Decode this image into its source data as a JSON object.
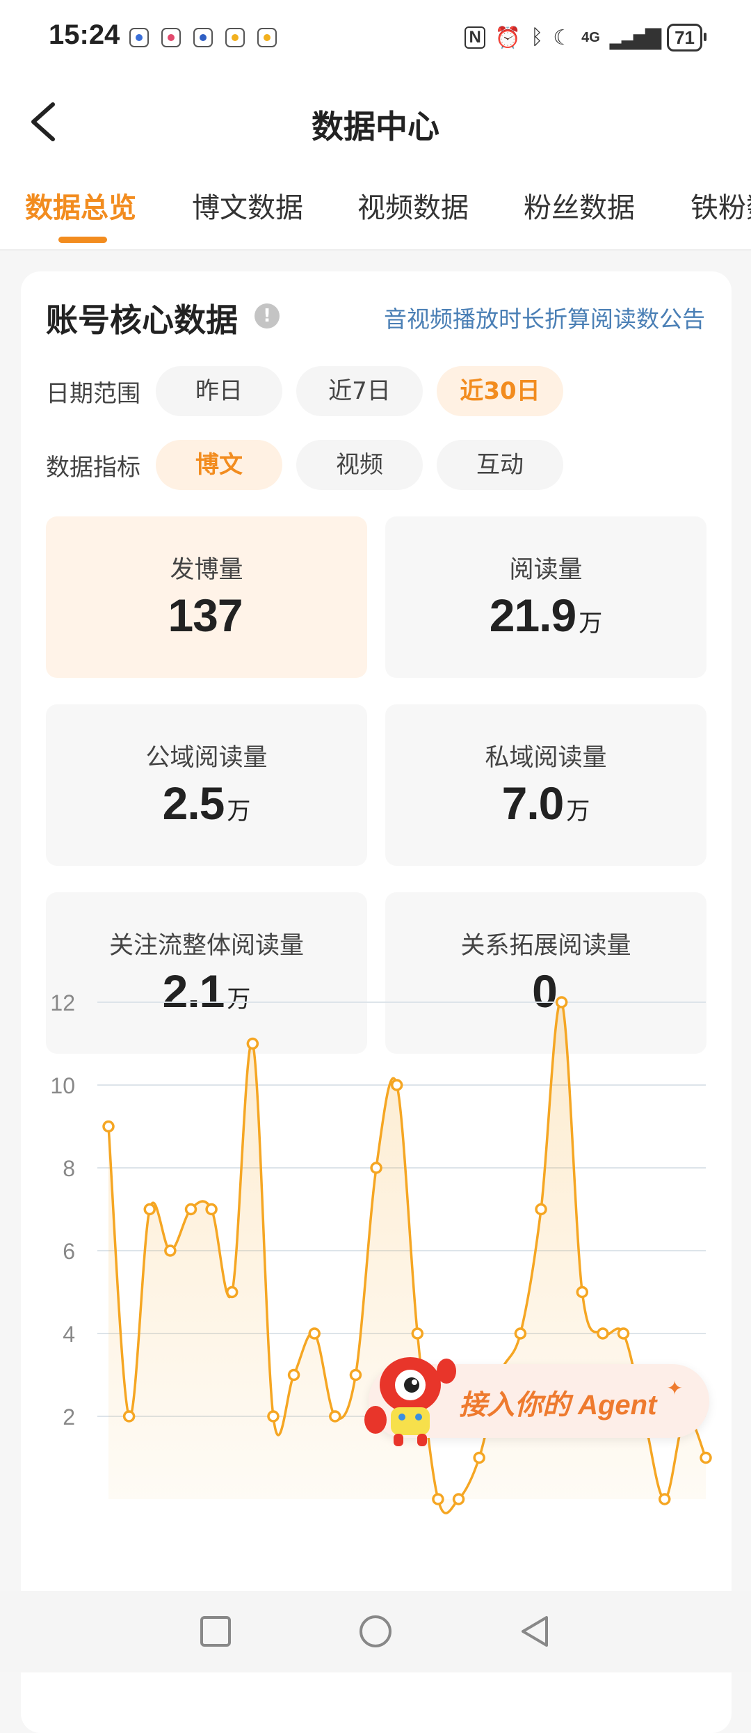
{
  "status_bar": {
    "time": "15:24",
    "notifications": [
      "app-notification-icon",
      "app-notification-icon",
      "app-notification-icon",
      "app-notification-icon",
      "app-notification-icon"
    ],
    "network": "4G",
    "battery": "71"
  },
  "header": {
    "title": "数据中心"
  },
  "tabs": [
    {
      "label": "数据总览",
      "active": true
    },
    {
      "label": "博文数据"
    },
    {
      "label": "视频数据"
    },
    {
      "label": "粉丝数据"
    },
    {
      "label": "铁粉数据"
    }
  ],
  "section": {
    "title": "账号核心数据",
    "notice": "音视频播放时长折算阅读数公告"
  },
  "filters": {
    "date_label": "日期范围",
    "date_options": [
      "昨日",
      "近7日",
      "近30日"
    ],
    "date_selected": "近30日",
    "metric_label": "数据指标",
    "metric_options": [
      "博文",
      "视频",
      "互动"
    ],
    "metric_selected": "博文"
  },
  "metrics": [
    {
      "label": "发博量",
      "value": "137",
      "unit": ""
    },
    {
      "label": "阅读量",
      "value": "21.9",
      "unit": "万"
    },
    {
      "label": "公域阅读量",
      "value": "2.5",
      "unit": "万"
    },
    {
      "label": "私域阅读量",
      "value": "7.0",
      "unit": "万"
    },
    {
      "label": "关注流整体阅读量",
      "value": "2.1",
      "unit": "万"
    },
    {
      "label": "关系拓展阅读量",
      "value": "0",
      "unit": ""
    }
  ],
  "chart_data": {
    "type": "area",
    "title": "",
    "xlabel": "",
    "ylabel": "",
    "yticks": [
      2,
      4,
      6,
      8,
      10,
      12
    ],
    "ylim": [
      0,
      12
    ],
    "grid": true,
    "color": "#f5a623",
    "x": [
      1,
      2,
      3,
      4,
      5,
      6,
      7,
      8,
      9,
      10,
      11,
      12,
      13,
      14,
      15,
      16,
      17,
      18,
      19,
      20,
      21,
      22,
      23,
      24,
      25,
      26,
      27,
      28,
      29,
      30
    ],
    "values": [
      9,
      2,
      7,
      6,
      7,
      7,
      5,
      11,
      2,
      3,
      4,
      2,
      3,
      8,
      10,
      4,
      0,
      0,
      1,
      3,
      4,
      7,
      12,
      5,
      4,
      4,
      2,
      0,
      2,
      1
    ]
  },
  "agent_banner": {
    "text": "接入你的 Agent"
  },
  "bottom_nav": [
    "recent-apps-icon",
    "home-icon",
    "back-icon"
  ],
  "colors": {
    "accent": "#f28c1f",
    "link": "#4a7fb5",
    "chart": "#f5a623"
  }
}
